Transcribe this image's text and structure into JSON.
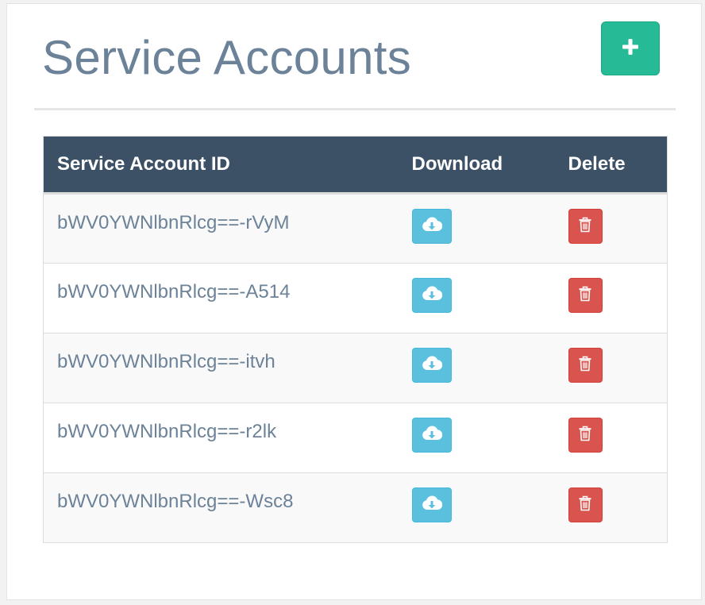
{
  "page": {
    "title": "Service Accounts",
    "add_button_icon": "plus-icon"
  },
  "table": {
    "headers": {
      "id": "Service Account ID",
      "download": "Download",
      "delete": "Delete"
    },
    "download_icon": "cloud-download-icon",
    "delete_icon": "trash-icon",
    "rows": [
      {
        "id": "bWV0YWNlbnRlcg==-rVyM"
      },
      {
        "id": "bWV0YWNlbnRlcg==-A514"
      },
      {
        "id": "bWV0YWNlbnRlcg==-itvh"
      },
      {
        "id": "bWV0YWNlbnRlcg==-r2lk"
      },
      {
        "id": "bWV0YWNlbnRlcg==-Wsc8"
      }
    ]
  },
  "colors": {
    "title": "#6b8299",
    "add_button": "#26bb96",
    "table_header": "#3d5166",
    "download_button": "#5bc0de",
    "delete_button": "#d9534f"
  }
}
